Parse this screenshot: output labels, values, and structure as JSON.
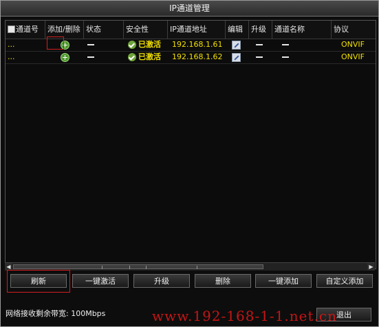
{
  "window": {
    "title": "IP通道管理"
  },
  "columns": [
    "通道号",
    "添加/删除",
    "状态",
    "安全性",
    "IP通道地址",
    "编辑",
    "升级",
    "通道名称",
    "协议"
  ],
  "rows": [
    {
      "channel": "...",
      "security": "已激活",
      "ip": "192.168.1.61",
      "protocol": "ONVIF"
    },
    {
      "channel": "...",
      "security": "已激活",
      "ip": "192.168.1.62",
      "protocol": "ONVIF"
    }
  ],
  "buttons": {
    "refresh": "刷新",
    "one_click_activate": "一键激活",
    "upgrade": "升级",
    "delete": "删除",
    "one_click_add": "一键添加",
    "custom_add": "自定义添加",
    "exit": "退出"
  },
  "status": {
    "bandwidth": "网络接收剩余带宽: 100Mbps"
  },
  "watermark": "www.192-168-1-1.net.cn",
  "icons": {
    "add": "plus-circle-icon",
    "activated": "check-circle-icon",
    "edit": "edit-icon",
    "empty": "dash-icon"
  },
  "colors": {
    "highlight_text": "#f2e000",
    "annotation_box": "#d32020",
    "watermark": "#d41616"
  }
}
